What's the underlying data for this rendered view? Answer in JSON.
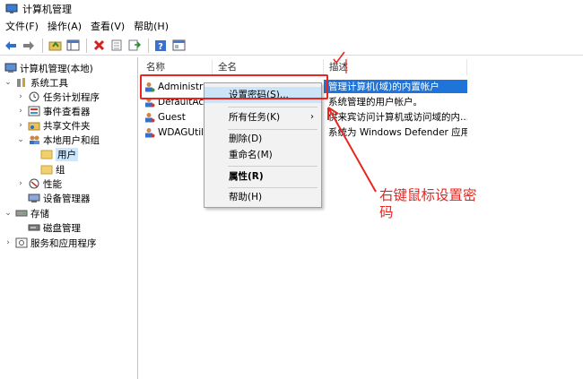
{
  "window": {
    "title": "计算机管理"
  },
  "menubar": {
    "items": [
      "文件(F)",
      "操作(A)",
      "查看(V)",
      "帮助(H)"
    ]
  },
  "toolbar": {
    "buttons": [
      "back-icon",
      "forward-icon",
      "up-folder-icon",
      "show-tree-icon",
      "delete-icon",
      "properties-icon",
      "export-icon",
      "help-icon",
      "view-icon"
    ]
  },
  "tree": {
    "root": "计算机管理(本地)",
    "system_tools": "系统工具",
    "task_scheduler": "任务计划程序",
    "event_viewer": "事件查看器",
    "shared_folders": "共享文件夹",
    "local_users_groups": "本地用户和组",
    "users": "用户",
    "groups": "组",
    "performance": "性能",
    "device_manager": "设备管理器",
    "storage": "存储",
    "disk_management": "磁盘管理",
    "services_apps": "服务和应用程序"
  },
  "list": {
    "columns": {
      "name": "名称",
      "full_name": "全名",
      "description": "描述"
    },
    "rows": [
      {
        "name": "Administrat",
        "full_name": "",
        "description": "管理计算机(域)的内置帐户"
      },
      {
        "name": "DefaultAcc",
        "full_name": "",
        "description": "系统管理的用户帐户。"
      },
      {
        "name": "Guest",
        "full_name": "",
        "description": "供来宾访问计算机或访问域的内..."
      },
      {
        "name": "WDAGUtili",
        "full_name": "",
        "description": "系统为 Windows Defender 应用..."
      }
    ]
  },
  "context_menu": {
    "set_password": "设置密码(S)...",
    "all_tasks": "所有任务(K)",
    "delete": "删除(D)",
    "rename": "重命名(M)",
    "properties": "属性(R)",
    "help": "帮助(H)"
  },
  "annotation": {
    "text": "右键鼠标设置密码"
  },
  "colors": {
    "selection": "#1e74d8",
    "annotation_red": "#e8261f",
    "menu_hover": "#cce4f7"
  }
}
